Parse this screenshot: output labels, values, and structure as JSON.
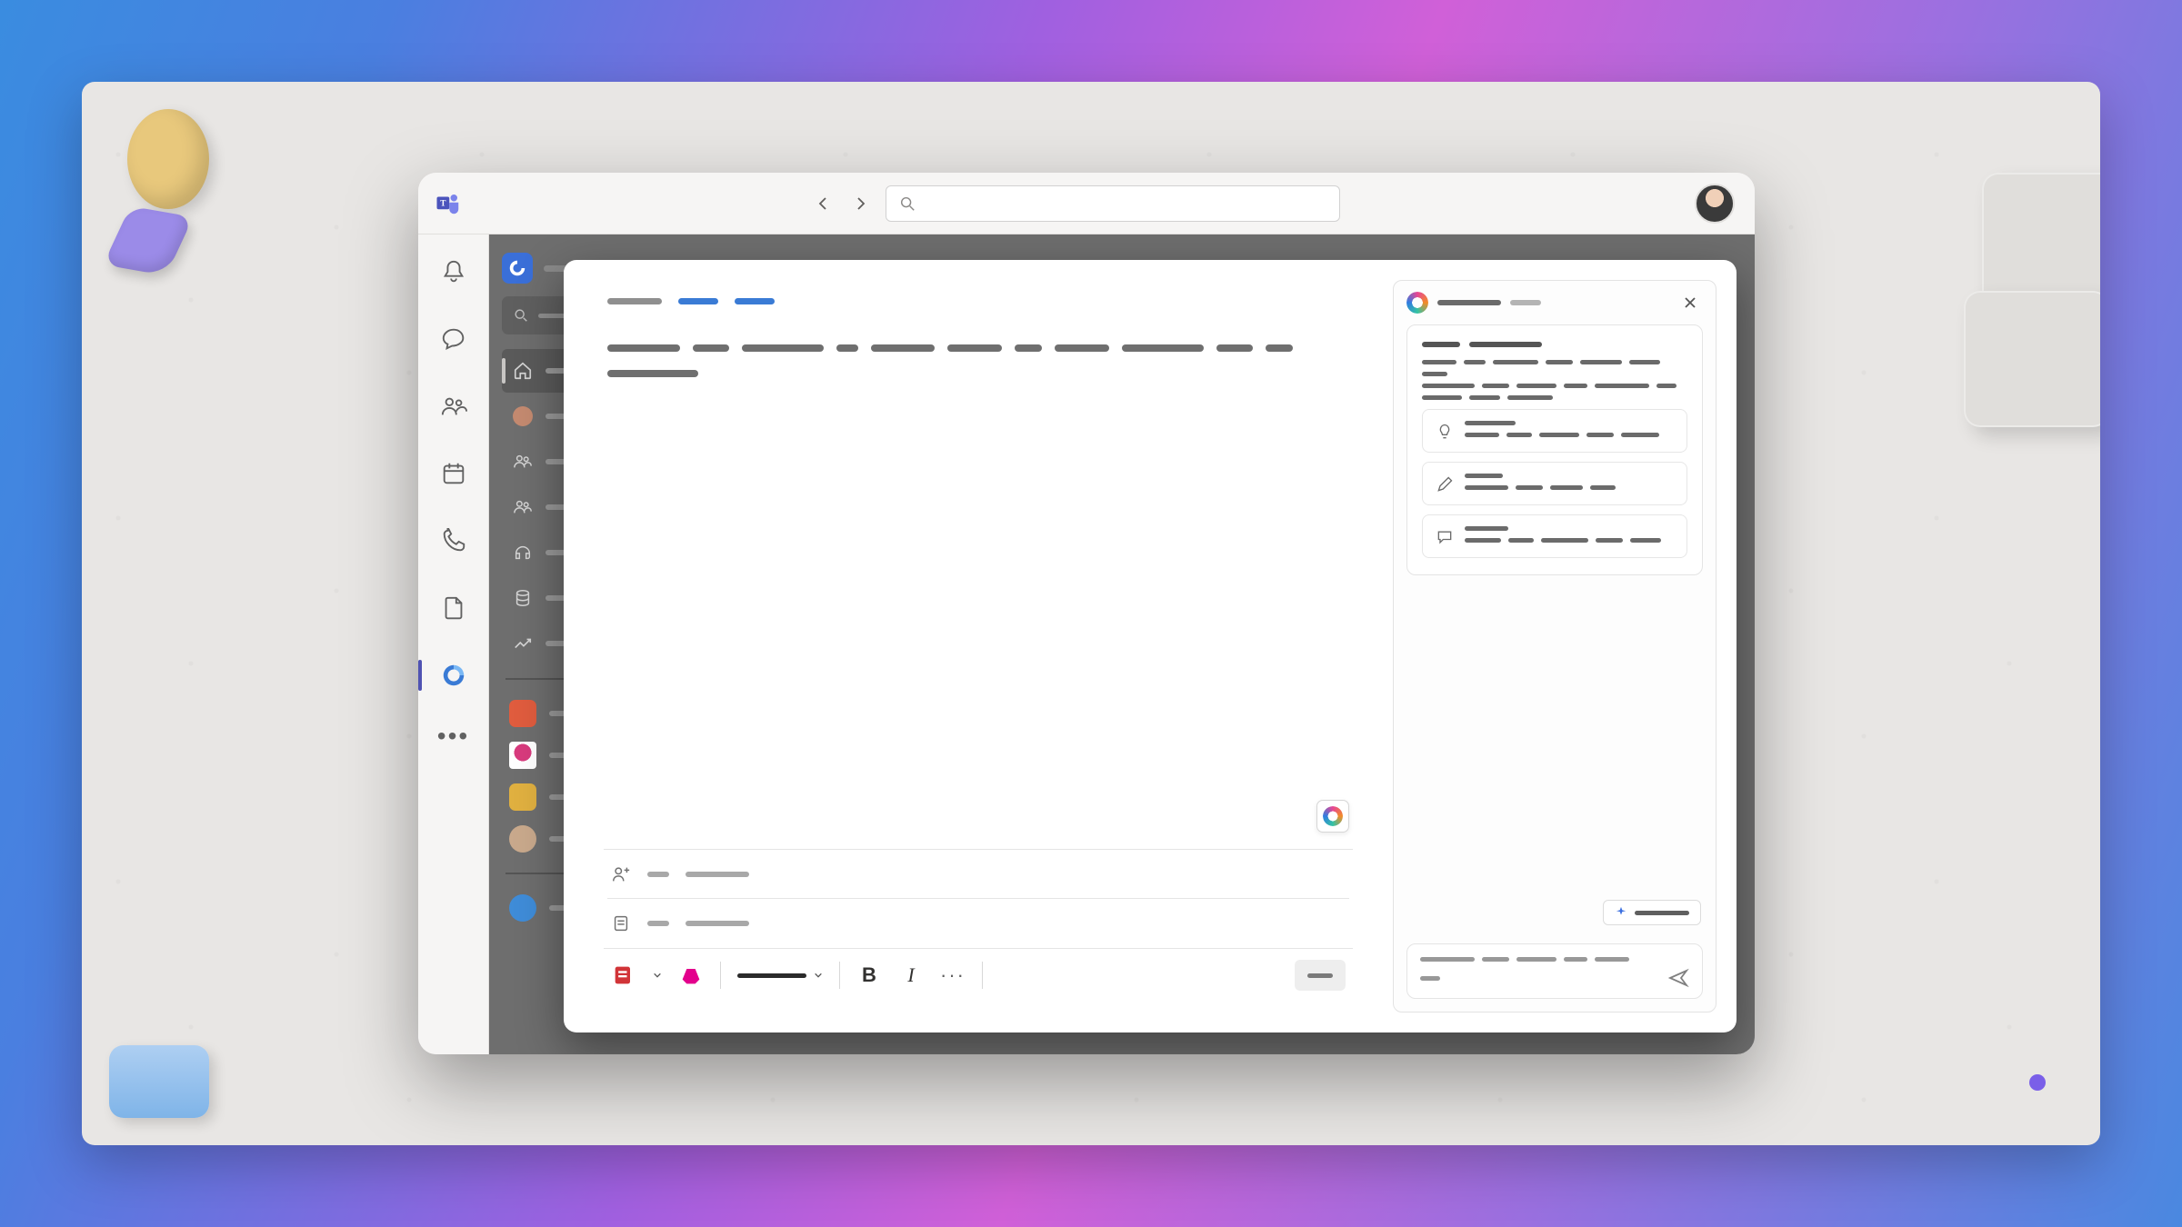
{
  "titlebar": {
    "search_placeholder": ""
  },
  "rail": {
    "items": [
      {
        "name": "activity"
      },
      {
        "name": "chat"
      },
      {
        "name": "teams"
      },
      {
        "name": "calendar"
      },
      {
        "name": "calls"
      },
      {
        "name": "files"
      },
      {
        "name": "loop",
        "active": true
      }
    ],
    "more_label": "•••"
  },
  "sidelist": {
    "search_placeholder": "",
    "nav": [
      {
        "icon": "home",
        "selected": true
      },
      {
        "icon": "avatar"
      },
      {
        "icon": "people"
      },
      {
        "icon": "people2"
      },
      {
        "icon": "headset"
      },
      {
        "icon": "database"
      },
      {
        "icon": "trend"
      }
    ],
    "pinned": [
      {
        "color": "#e05c3e"
      },
      {
        "color": "#d83b7d"
      },
      {
        "color": "#e0b040"
      },
      {
        "color": "#c9a98c"
      },
      {
        "color": "#3f8cd8"
      }
    ]
  },
  "doc": {
    "breadcrumb": [
      "",
      "",
      ""
    ],
    "attendees_label": "",
    "notes_label": "",
    "toolbar": {
      "font_label": "",
      "bold_label": "B",
      "italic_label": "I",
      "more_label": "···",
      "send_label": ""
    }
  },
  "copilot": {
    "title": "",
    "subtitle": "",
    "intro_title": "",
    "options": [
      {
        "icon": "lightbulb",
        "title": "",
        "desc": ""
      },
      {
        "icon": "pencil",
        "title": "",
        "desc": ""
      },
      {
        "icon": "chat",
        "title": "",
        "desc": ""
      }
    ],
    "chip_label": "",
    "input_placeholder": ""
  }
}
